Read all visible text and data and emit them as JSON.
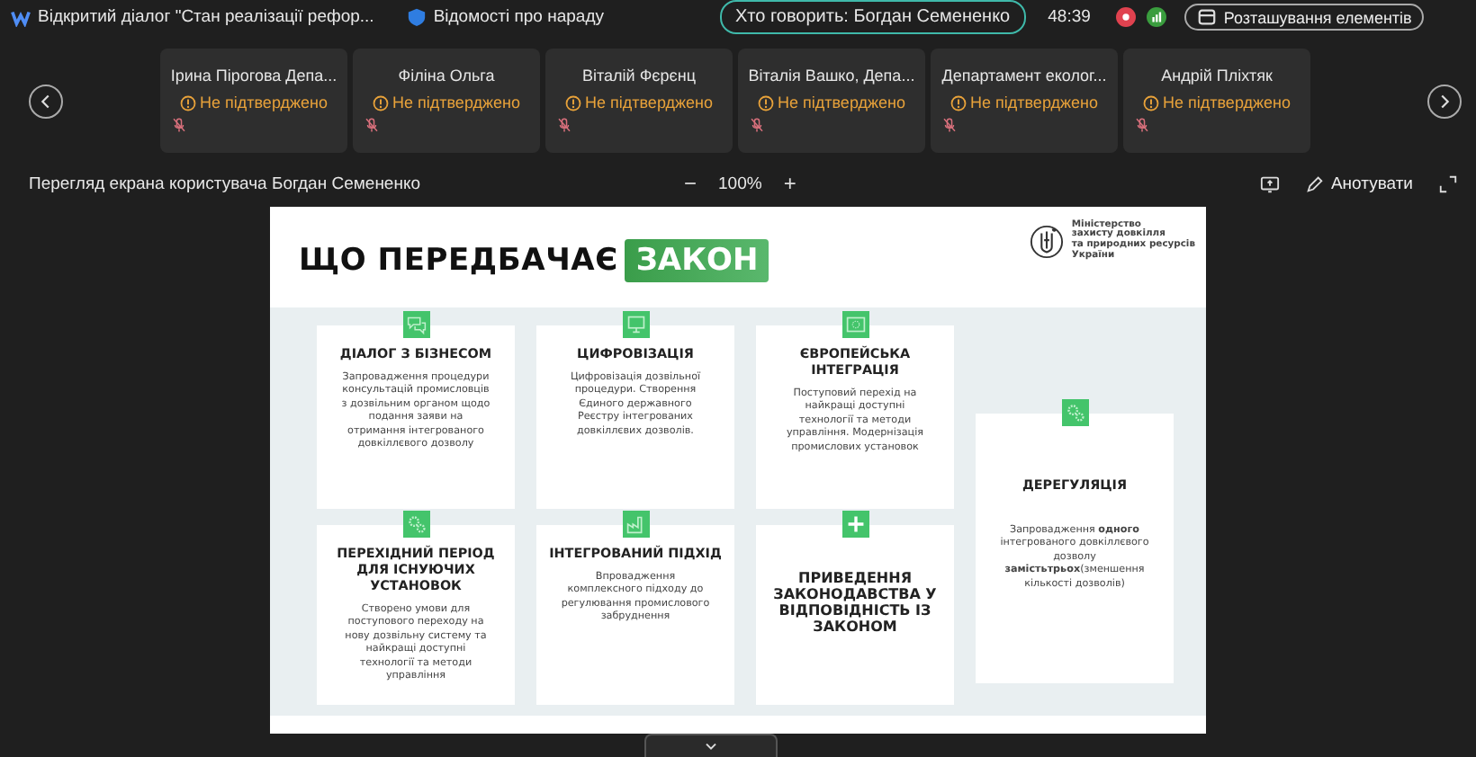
{
  "title_bar": {
    "items": [
      {
        "kind": "meeting",
        "label": "Відкритий діалог \"Стан реалізації рефор..."
      },
      {
        "kind": "info",
        "label": "Відомості про нараду"
      }
    ],
    "speaker": "Хто говорить: Богдан Семененко",
    "timer": "48:39",
    "layout_button": "Розташування елементів"
  },
  "participants": [
    {
      "name": "Ірина Пірогова Депа...",
      "status": "Не підтверджено",
      "muted": true
    },
    {
      "name": "Філіна Ольга",
      "status": "Не підтверджено",
      "muted": true
    },
    {
      "name": "Віталій Фєрєнц",
      "status": "Не підтверджено",
      "muted": true
    },
    {
      "name": "Віталія Вашко, Депа...",
      "status": "Не підтверджено",
      "muted": true
    },
    {
      "name": "Департамент еколог...",
      "status": "Не підтверджено",
      "muted": true
    },
    {
      "name": "Андрій Пліхтяк",
      "status": "Не підтверджено",
      "muted": true
    }
  ],
  "share_toolbar": {
    "title": "Перегляд екрана користувача Богдан Семененко",
    "zoom_out": "−",
    "zoom": "100%",
    "zoom_in": "+",
    "annotate": "Анотувати"
  },
  "slide": {
    "title": "ЩО ПЕРЕДБАЧАЄ",
    "title_highlight": "ЗАКОН",
    "ministry": [
      "Міністерство",
      "захисту довкілля",
      "та природних ресурсів",
      "України"
    ],
    "cards": [
      {
        "kind": "chat",
        "title": "ДІАЛОГ З БІЗНЕСОМ",
        "text": "Запровадження процедури консультацій промисловців з дозвільним органом щодо подання заяви на отримання інтегрованого довкіллєвого дозволу"
      },
      {
        "kind": "monitor",
        "title": "ЦИФРОВІЗАЦІЯ",
        "text": "Цифровізація дозвільної процедури. Створення Єдиного державного Реєстру інтегрованих довкіллєвих дозволів."
      },
      {
        "kind": "flag",
        "title": "ЄВРОПЕЙСЬКА ІНТЕГРАЦІЯ",
        "text": "Поступовий перехід на найкращі доступні технології та методи управління. Модернізація промислових установок"
      },
      {
        "kind": "gears",
        "title": "ДЕРЕГУЛЯЦІЯ",
        "text": "Запровадження **одного** інтегрованого довкіллєвого дозволу **замістьтрьох**(зменшення кількості дозволів)"
      },
      {
        "kind": "gears",
        "title": "ПЕРЕХІДНИЙ ПЕРІОД ДЛЯ ІСНУЮЧИХ УСТАНОВОК",
        "text": "Створено умови для поступового переходу на нову дозвільну систему та найкращі доступні технології та методи управління"
      },
      {
        "kind": "factory",
        "title": "ІНТЕГРОВАНИЙ ПІДХІД",
        "text": "Впровадження комплексного підходу до регулювання промислового забруднення"
      },
      {
        "kind": "plus",
        "title": "ПРИВЕДЕННЯ ЗАКОНОДАВСТВА У ВІДПОВІДНІСТЬ ІЗ ЗАКОНОМ"
      }
    ]
  }
}
